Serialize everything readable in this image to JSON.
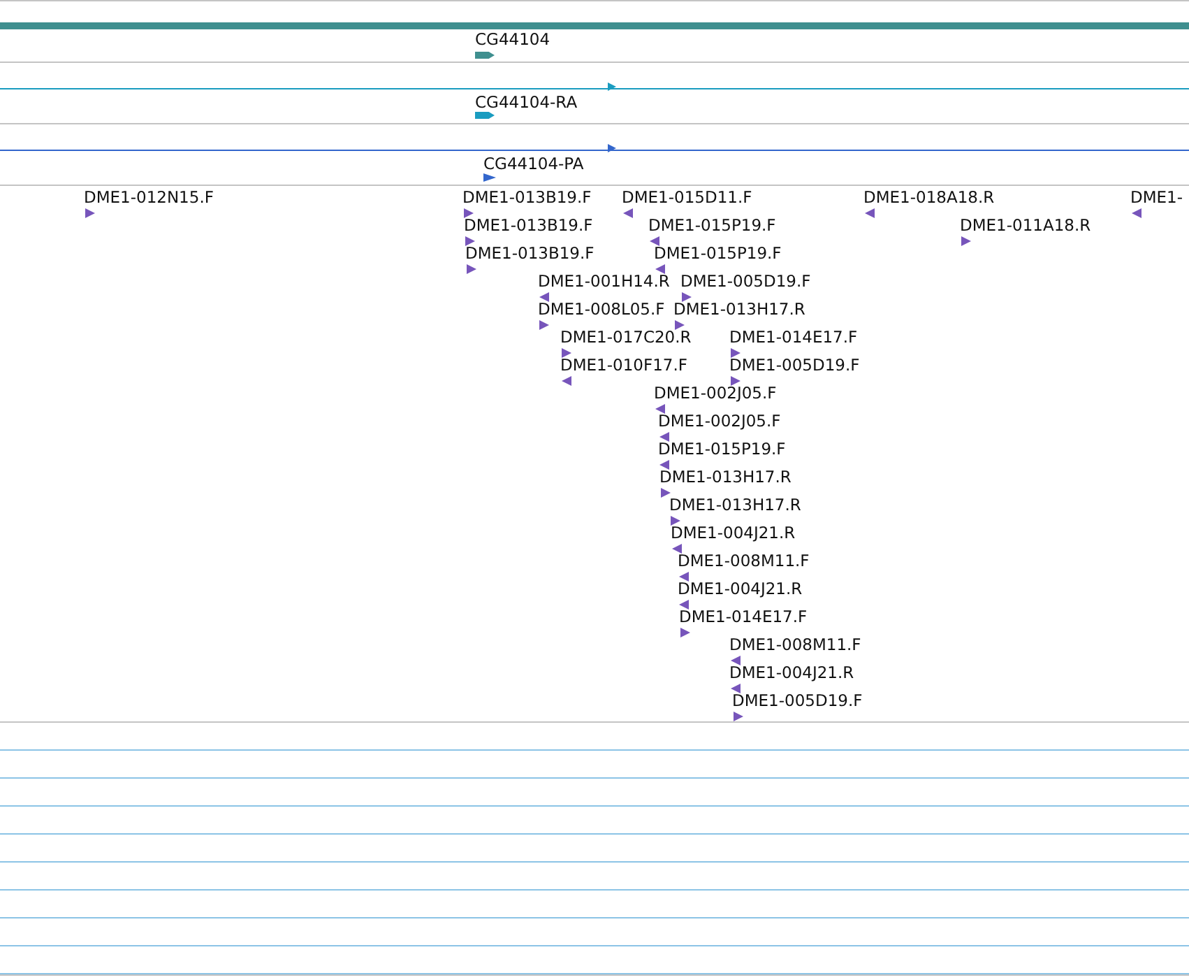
{
  "gene_track": {
    "label": "CG44104"
  },
  "transcripts": [
    {
      "label": "CG44104-RA",
      "kind": "rna"
    },
    {
      "label": "CG44104-PA",
      "kind": "protein"
    }
  ],
  "features": [
    {
      "label": "DME1-012N15.F",
      "reverse": false
    },
    {
      "label": "DME1-013B19.F",
      "reverse": false
    },
    {
      "label": "DME1-015D11.F",
      "reverse": true
    },
    {
      "label": "DME1-018A18.R",
      "reverse": true
    },
    {
      "label": "DME1-",
      "reverse": true
    },
    {
      "label": "DME1-013B19.F",
      "reverse": false
    },
    {
      "label": "DME1-015P19.F",
      "reverse": true
    },
    {
      "label": "DME1-011A18.R",
      "reverse": false
    },
    {
      "label": "DME1-013B19.F",
      "reverse": false
    },
    {
      "label": "DME1-015P19.F",
      "reverse": true
    },
    {
      "label": "DME1-001H14.R",
      "reverse": true
    },
    {
      "label": "DME1-005D19.F",
      "reverse": false
    },
    {
      "label": "DME1-008L05.F",
      "reverse": false
    },
    {
      "label": "DME1-013H17.R",
      "reverse": false
    },
    {
      "label": "DME1-017C20.R",
      "reverse": false
    },
    {
      "label": "DME1-014E17.F",
      "reverse": false
    },
    {
      "label": "DME1-010F17.F",
      "reverse": true
    },
    {
      "label": "DME1-005D19.F",
      "reverse": false
    },
    {
      "label": "DME1-002J05.F",
      "reverse": true
    },
    {
      "label": "DME1-002J05.F",
      "reverse": true
    },
    {
      "label": "DME1-015P19.F",
      "reverse": true
    },
    {
      "label": "DME1-013H17.R",
      "reverse": false
    },
    {
      "label": "DME1-013H17.R",
      "reverse": false
    },
    {
      "label": "DME1-004J21.R",
      "reverse": true
    },
    {
      "label": "DME1-008M11.F",
      "reverse": true
    },
    {
      "label": "DME1-004J21.R",
      "reverse": true
    },
    {
      "label": "DME1-014E17.F",
      "reverse": false
    },
    {
      "label": "DME1-008M11.F",
      "reverse": true
    },
    {
      "label": "DME1-004J21.R",
      "reverse": true
    },
    {
      "label": "DME1-005D19.F",
      "reverse": false
    }
  ]
}
